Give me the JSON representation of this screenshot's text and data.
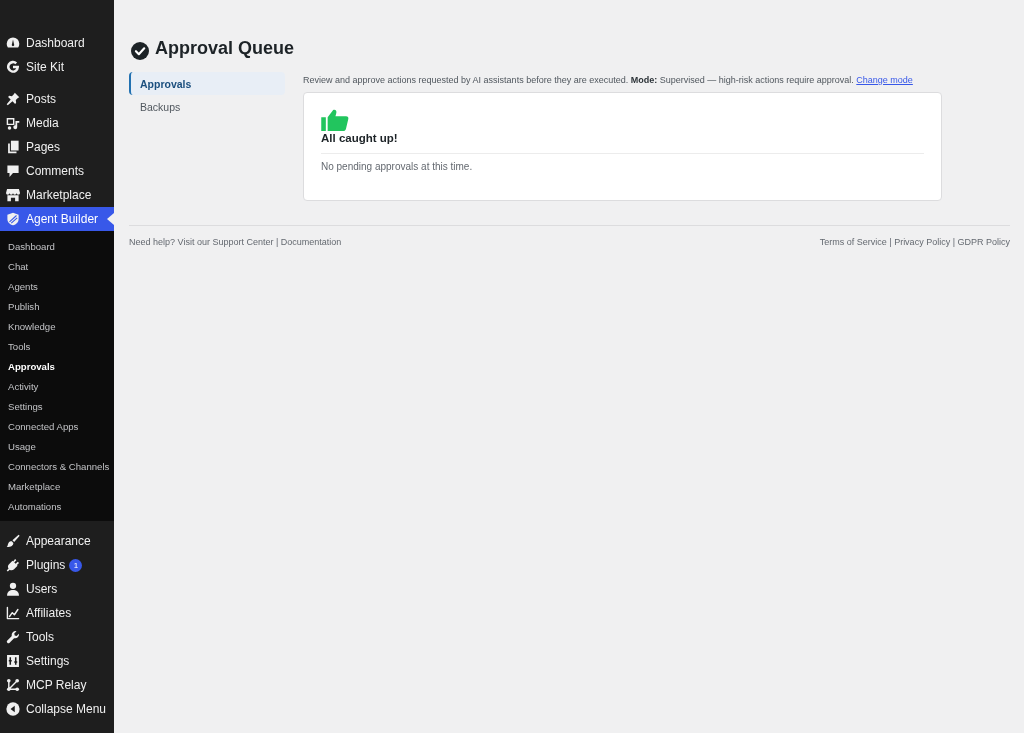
{
  "sidebar": {
    "groups": [
      {
        "items": [
          {
            "label": "Dashboard",
            "selected": false
          },
          {
            "label": "Site Kit",
            "selected": false
          }
        ]
      },
      {
        "items": [
          {
            "label": "Posts",
            "selected": false
          },
          {
            "label": "Media",
            "selected": false
          },
          {
            "label": "Pages",
            "selected": false
          },
          {
            "label": "Comments",
            "selected": false
          },
          {
            "label": "Marketplace",
            "selected": false
          },
          {
            "label": "Agent Builder",
            "selected": true,
            "submenu": [
              {
                "label": "Dashboard",
                "selected": false
              },
              {
                "label": "Chat",
                "selected": false
              },
              {
                "label": "Agents",
                "selected": false
              },
              {
                "label": "Publish",
                "selected": false
              },
              {
                "label": "Knowledge",
                "selected": false
              },
              {
                "label": "Tools",
                "selected": false
              },
              {
                "label": "Approvals",
                "selected": true
              },
              {
                "label": "Activity",
                "selected": false
              },
              {
                "label": "Settings",
                "selected": false
              },
              {
                "label": "Connected Apps",
                "selected": false
              },
              {
                "label": "Usage",
                "selected": false
              },
              {
                "label": "Connectors & Channels",
                "selected": false
              },
              {
                "label": "Marketplace",
                "selected": false
              },
              {
                "label": "Automations",
                "selected": false
              }
            ]
          }
        ]
      },
      {
        "items": [
          {
            "label": "Appearance",
            "selected": false
          },
          {
            "label": "Plugins",
            "selected": false,
            "badge": "1"
          },
          {
            "label": "Users",
            "selected": false
          },
          {
            "label": "Affiliates",
            "selected": false
          },
          {
            "label": "Tools",
            "selected": false
          },
          {
            "label": "Settings",
            "selected": false
          },
          {
            "label": "MCP Relay",
            "selected": false
          },
          {
            "label": "Collapse Menu",
            "selected": false
          }
        ]
      }
    ]
  },
  "page": {
    "title": "Approval Queue",
    "tabs": [
      {
        "label": "Approvals",
        "selected": true
      },
      {
        "label": "Backups",
        "selected": false
      }
    ],
    "description": "Review and approve actions requested by AI assistants before they are executed. **Mode:** Supervised — high-risk actions require approval.",
    "change_mode_link": "Change mode",
    "empty_state": {
      "heading": "All caught up!",
      "message": "No pending approvals at this time."
    }
  },
  "footer": {
    "help_lead": "Need help? Visit our",
    "help_links": [
      "Support Center",
      "Documentation"
    ],
    "legal_links": [
      "Terms of Service",
      "Privacy Policy",
      "GDPR Policy"
    ],
    "separator": "|"
  }
}
